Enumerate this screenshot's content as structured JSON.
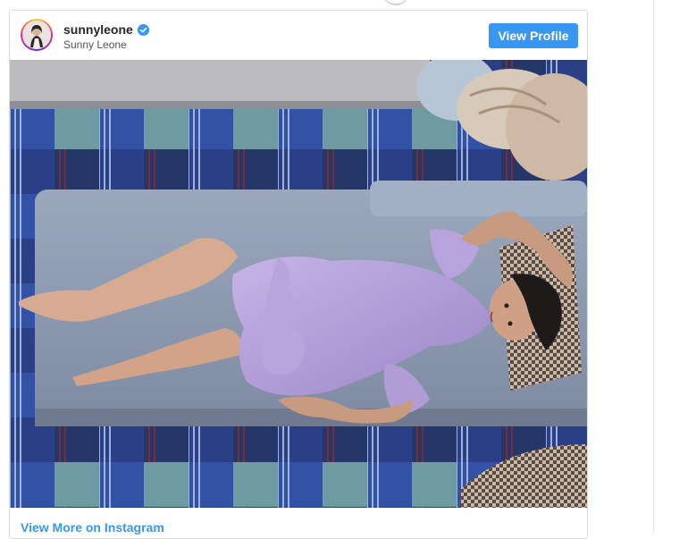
{
  "post": {
    "username": "sunnyleone",
    "full_name": "Sunny Leone",
    "verified": true,
    "view_profile_label": "View Profile",
    "view_more_label": "View More on Instagram"
  },
  "icons": {
    "verified": "verified-badge-icon",
    "avatar": "profile-avatar"
  },
  "colors": {
    "accent": "#3897f0",
    "text_primary": "#262626",
    "border": "#dbdbdb"
  }
}
